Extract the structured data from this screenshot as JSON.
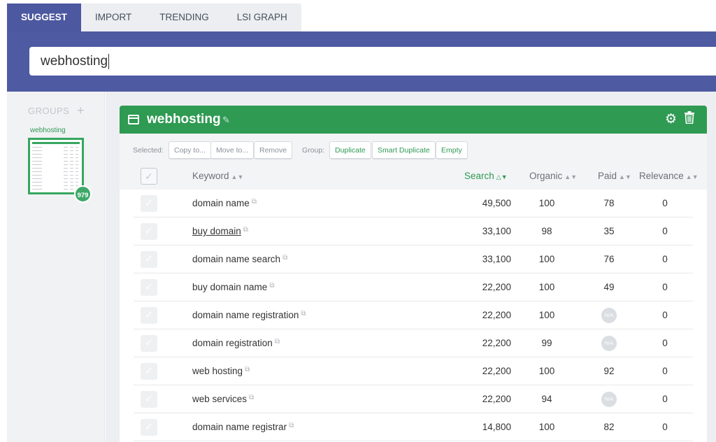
{
  "tabs": [
    {
      "label": "SUGGEST",
      "active": true
    },
    {
      "label": "IMPORT",
      "active": false
    },
    {
      "label": "TRENDING",
      "active": false
    },
    {
      "label": "LSI GRAPH",
      "active": false
    }
  ],
  "search": {
    "value": "webhosting"
  },
  "sidebar": {
    "header": "GROUPS",
    "add": "+",
    "group_name": "webhosting",
    "badge": "979"
  },
  "panel": {
    "title": "webhosting",
    "toolbar": {
      "selected_label": "Selected:",
      "copy": "Copy to...",
      "move": "Move to...",
      "remove": "Remove",
      "group_label": "Group:",
      "duplicate": "Duplicate",
      "smart_duplicate": "Smart Duplicate",
      "empty": "Empty"
    },
    "columns": {
      "keyword": "Keyword",
      "search": "Search",
      "organic": "Organic",
      "paid": "Paid",
      "relevance": "Relevance"
    },
    "rows": [
      {
        "keyword": "domain name",
        "search": "49,500",
        "organic": "100",
        "paid": "78",
        "relevance": "0"
      },
      {
        "keyword": "buy domain",
        "search": "33,100",
        "organic": "98",
        "paid": "35",
        "relevance": "0"
      },
      {
        "keyword": "domain name search",
        "search": "33,100",
        "organic": "100",
        "paid": "76",
        "relevance": "0"
      },
      {
        "keyword": "buy domain name",
        "search": "22,200",
        "organic": "100",
        "paid": "49",
        "relevance": "0"
      },
      {
        "keyword": "domain name registration",
        "search": "22,200",
        "organic": "100",
        "paid": "N/A",
        "relevance": "0"
      },
      {
        "keyword": "domain registration",
        "search": "22,200",
        "organic": "99",
        "paid": "N/A",
        "relevance": "0"
      },
      {
        "keyword": "web hosting",
        "search": "22,200",
        "organic": "100",
        "paid": "92",
        "relevance": "0"
      },
      {
        "keyword": "web services",
        "search": "22,200",
        "organic": "94",
        "paid": "N/A",
        "relevance": "0"
      },
      {
        "keyword": "domain name registrar",
        "search": "14,800",
        "organic": "100",
        "paid": "82",
        "relevance": "0"
      }
    ]
  },
  "colors": {
    "accent_blue": "#4e5aa1",
    "accent_green": "#2e9a52"
  }
}
